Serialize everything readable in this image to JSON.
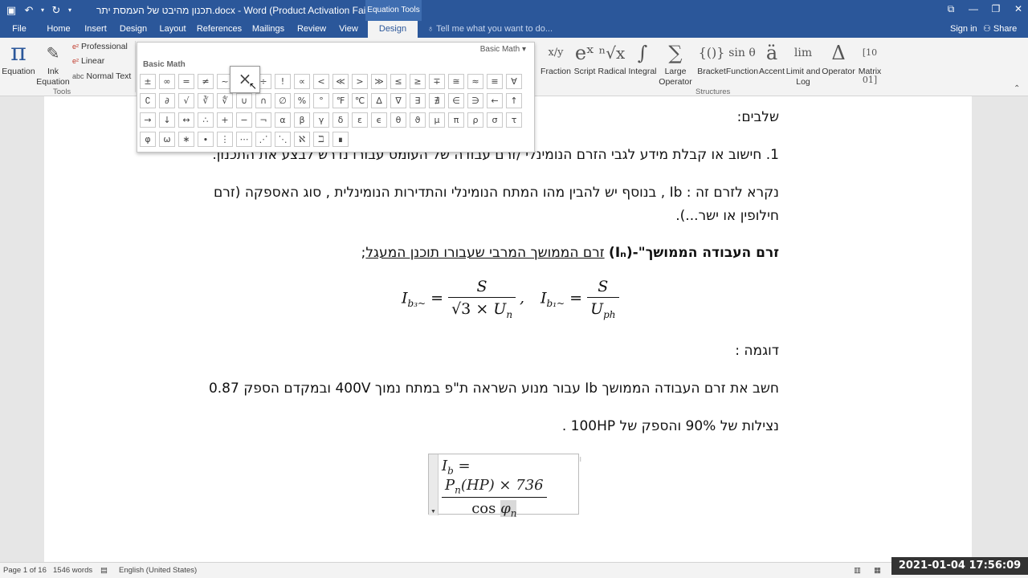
{
  "titlebar": {
    "document_title": "תכנון מהיבט של העמסת יתר.docx - Word (Product Activation Failed)",
    "contextual_group": "Equation Tools"
  },
  "tabs": [
    {
      "label": "File",
      "active": false
    },
    {
      "label": "Home",
      "active": false
    },
    {
      "label": "Insert",
      "active": false
    },
    {
      "label": "Design",
      "active": false
    },
    {
      "label": "Layout",
      "active": false
    },
    {
      "label": "References",
      "active": false
    },
    {
      "label": "Mailings",
      "active": false
    },
    {
      "label": "Review",
      "active": false
    },
    {
      "label": "View",
      "active": false
    },
    {
      "label": "Design",
      "active": true
    }
  ],
  "tell_me": "Tell me what you want to do...",
  "signin": "Sign in",
  "share": "Share",
  "ribbon": {
    "tools": {
      "equation_label": "Equation",
      "ink_label_1": "Ink",
      "ink_label_2": "Equation",
      "professional": "Professional",
      "linear": "Linear",
      "normal_text": "Normal Text",
      "group_label": "Tools"
    },
    "structures": [
      {
        "label": "Fraction",
        "glyph": "x/y"
      },
      {
        "label": "Script",
        "glyph": "eˣ"
      },
      {
        "label": "Radical",
        "glyph": "ⁿ√x"
      },
      {
        "label": "Integral",
        "glyph": "∫"
      },
      {
        "label": "Large",
        "label2": "Operator",
        "glyph": "∑"
      },
      {
        "label": "Bracket",
        "glyph": "{()}"
      },
      {
        "label": "Function",
        "glyph": "sin θ"
      },
      {
        "label": "Accent",
        "glyph": "ä"
      },
      {
        "label": "Limit and",
        "label2": "Log",
        "glyph": "lim"
      },
      {
        "label": "Operator",
        "glyph": "Δ"
      },
      {
        "label": "Matrix",
        "glyph": "[10 01]"
      }
    ],
    "structures_label": "Structures"
  },
  "gallery": {
    "dropdown": "Basic Math",
    "title": "Basic Math",
    "rows": [
      [
        "±",
        "∞",
        "=",
        "≠",
        "~",
        "×",
        "÷",
        "!",
        "∝",
        "<",
        "≪",
        ">",
        "≫",
        "≤",
        "≥",
        "∓",
        "≅",
        "≈",
        "≡",
        "∀"
      ],
      [
        "∁",
        "∂",
        "√",
        "∛",
        "∜",
        "∪",
        "∩",
        "∅",
        "%",
        "°",
        "℉",
        "℃",
        "∆",
        "∇",
        "∃",
        "∄",
        "∈",
        "∋",
        "←",
        "↑"
      ],
      [
        "→",
        "↓",
        "↔",
        "∴",
        "+",
        "−",
        "¬",
        "α",
        "β",
        "γ",
        "δ",
        "ε",
        "ϵ",
        "θ",
        "ϑ",
        "μ",
        "π",
        "ρ",
        "σ",
        "τ"
      ],
      [
        "φ",
        "ω",
        "∗",
        "∙",
        "⋮",
        "⋯",
        "⋰",
        "⋱",
        "ℵ",
        "ℶ",
        "∎"
      ]
    ],
    "hover_symbol": "×"
  },
  "document": {
    "line1": "שלבים:",
    "line2": "1. חישוב או קבלת מידע לגבי הזרם הנומינלי /זרם עבודה של העומס עבורו נדרש לבצע את התכנון.",
    "line3a_pre": "נקרא לזרם זה :  ",
    "line3a_ib": "Ib",
    "line3a_post": " , בנוסף יש להבין מהו המתח הנומינלי והתדירות הנומינלית , סוג האספקה (זרם",
    "line3b": "חילופין או ישר...).",
    "line4_bold": "זרם העבודה הממושך\"",
    "line4_mid": "-(Iₙ)",
    "line4_underline": "זרם הממושך המרבי שעבורו תוכנן המעגל",
    "line4_end": ";",
    "line5": "דוגמה :",
    "line6": "חשב את זרם העבודה הממושך Ib עבור מנוע השראה ת\"פ במתח נמוך 400V ובמקדם הספק 0.87",
    "line7": "נצילות של 90% והספק של 100HP ."
  },
  "equations": {
    "eq1_lhs": "I",
    "eq1_sub": "b₃~",
    "eq1_num": "S",
    "eq1_den_sqrt": "√3",
    "eq1_den_rest": "× U",
    "eq1_den_sub": "n",
    "sep": ",",
    "eq2_lhs": "I",
    "eq2_sub": "b₁~",
    "eq2_num": "S",
    "eq2_den": "U",
    "eq2_den_sub": "ph",
    "eq3_lhs": "I",
    "eq3_sub": "b",
    "eq3_num_a": "P",
    "eq3_num_sub": "n",
    "eq3_num_b": "(HP) × 736",
    "eq3_den_a": "cos ",
    "eq3_den_b": "φ",
    "eq3_den_sub": "n"
  },
  "statusbar": {
    "page": "Page 1 of 16",
    "words": "1546 words",
    "language": "English (United States)"
  },
  "timestamp": "2021-01-04  17:56:09"
}
